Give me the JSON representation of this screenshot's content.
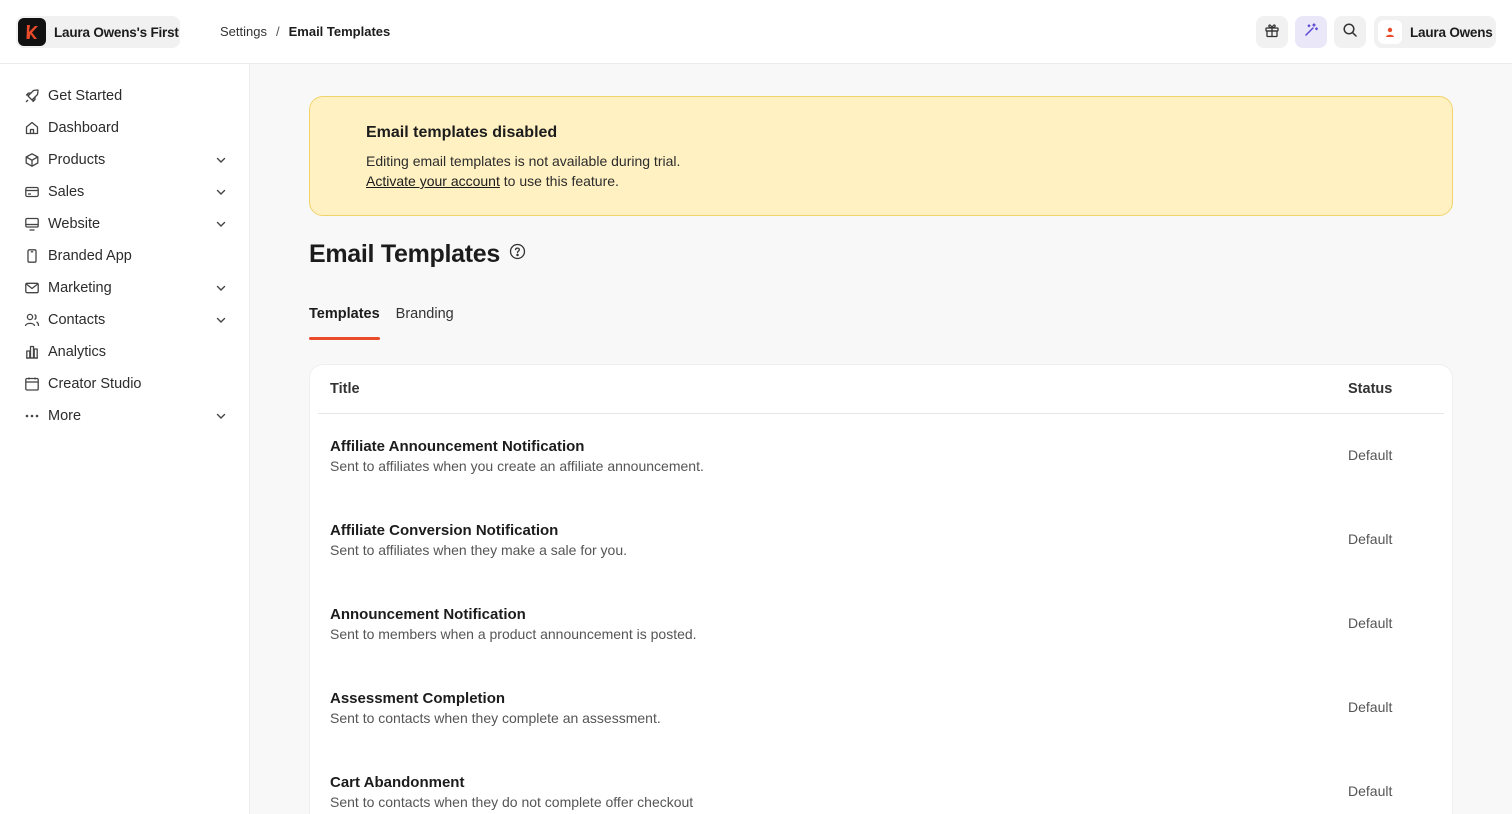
{
  "topbar": {
    "site_name": "Laura Owens's First",
    "breadcrumb": [
      "Settings",
      "Email Templates"
    ],
    "user_name": "Laura Owens"
  },
  "colors": {
    "accent": "#ea4b2a",
    "banner_bg": "#fff1c2",
    "banner_border": "#f2d36b",
    "ai_button": "#5b47d6"
  },
  "sidebar": {
    "items": [
      {
        "label": "Get Started",
        "icon": "rocket-icon",
        "expandable": false
      },
      {
        "label": "Dashboard",
        "icon": "home-icon",
        "expandable": false
      },
      {
        "label": "Products",
        "icon": "box-icon",
        "expandable": true
      },
      {
        "label": "Sales",
        "icon": "credit-card-icon",
        "expandable": true
      },
      {
        "label": "Website",
        "icon": "monitor-icon",
        "expandable": true
      },
      {
        "label": "Branded App",
        "icon": "mobile-icon",
        "expandable": false
      },
      {
        "label": "Marketing",
        "icon": "mail-icon",
        "expandable": true
      },
      {
        "label": "Contacts",
        "icon": "users-icon",
        "expandable": true
      },
      {
        "label": "Analytics",
        "icon": "bar-chart-icon",
        "expandable": false
      },
      {
        "label": "Creator Studio",
        "icon": "calendar-icon",
        "expandable": false
      },
      {
        "label": "More",
        "icon": "more-dots-icon",
        "expandable": true
      }
    ]
  },
  "banner": {
    "title": "Email templates disabled",
    "line1": "Editing email templates is not available during trial.",
    "link": "Activate your account",
    "line2_rest": " to use this feature."
  },
  "page": {
    "title": "Email Templates",
    "tabs": [
      {
        "label": "Templates",
        "active": true
      },
      {
        "label": "Branding",
        "active": false
      }
    ]
  },
  "table": {
    "columns": [
      "Title",
      "Status"
    ],
    "rows": [
      {
        "title": "Affiliate Announcement Notification",
        "desc": "Sent to affiliates when you create an affiliate announcement.",
        "status": "Default"
      },
      {
        "title": "Affiliate Conversion Notification",
        "desc": "Sent to affiliates when they make a sale for you.",
        "status": "Default"
      },
      {
        "title": "Announcement Notification",
        "desc": "Sent to members when a product announcement is posted.",
        "status": "Default"
      },
      {
        "title": "Assessment Completion",
        "desc": "Sent to contacts when they complete an assessment.",
        "status": "Default"
      },
      {
        "title": "Cart Abandonment",
        "desc": "Sent to contacts when they do not complete offer checkout",
        "status": "Default"
      }
    ]
  }
}
